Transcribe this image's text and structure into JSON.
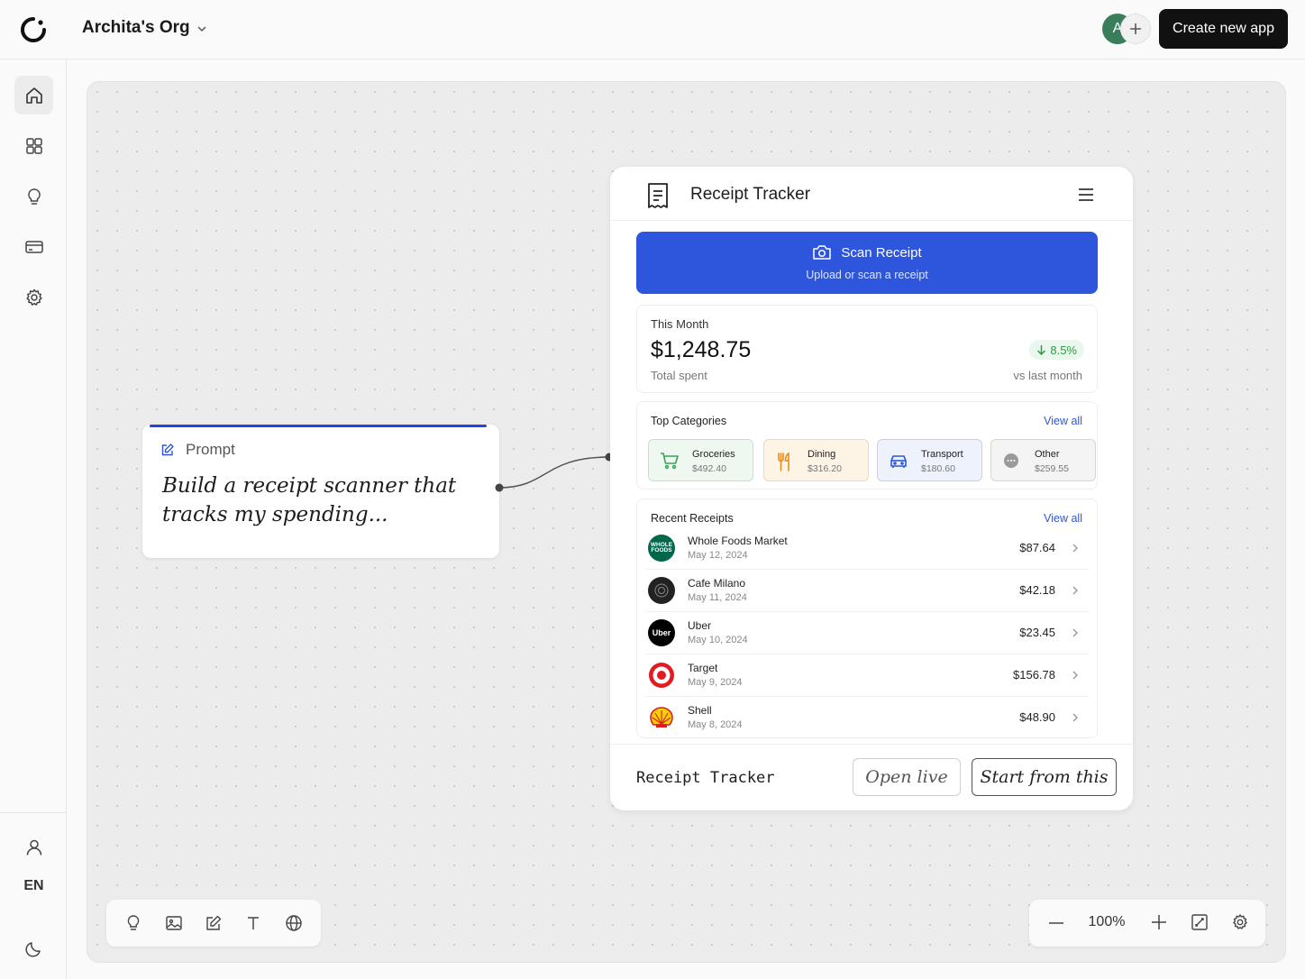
{
  "header": {
    "org_name": "Archita's Org",
    "avatar_initial": "A",
    "create_button": "Create new app"
  },
  "sidebar": {
    "items": [
      {
        "name": "home",
        "icon": "home-icon",
        "active": true
      },
      {
        "name": "apps",
        "icon": "grid-icon"
      },
      {
        "name": "ideas",
        "icon": "lightbulb-icon"
      },
      {
        "name": "billing",
        "icon": "credit-card-icon"
      },
      {
        "name": "settings",
        "icon": "gear-icon"
      }
    ],
    "bottom": {
      "profile_icon": "user-icon",
      "language": "EN",
      "theme_icon": "moon-icon"
    }
  },
  "prompt_node": {
    "label": "Prompt",
    "text": "Build a receipt scanner that tracks my spending..."
  },
  "app_preview": {
    "title": "Receipt Tracker",
    "scan": {
      "label": "Scan Receipt",
      "sublabel": "Upload or scan a receipt"
    },
    "this_month": {
      "label": "This Month",
      "amount": "$1,248.75",
      "sublabel": "Total spent",
      "change": "8.5%",
      "change_direction": "down",
      "change_label": "vs last month"
    },
    "categories": {
      "title": "Top Categories",
      "view_all": "View all",
      "items": [
        {
          "name": "Groceries",
          "amount": "$492.40",
          "icon": "cart-icon",
          "color": "#3aa356"
        },
        {
          "name": "Dining",
          "amount": "$316.20",
          "icon": "utensils-icon",
          "color": "#e6932a"
        },
        {
          "name": "Transport",
          "amount": "$180.60",
          "icon": "car-icon",
          "color": "#2d56dd"
        },
        {
          "name": "Other",
          "amount": "$259.55",
          "icon": "more-icon",
          "color": "#777777"
        }
      ]
    },
    "recent": {
      "title": "Recent Receipts",
      "view_all": "View all",
      "items": [
        {
          "merchant": "Whole Foods Market",
          "date": "May 12, 2024",
          "amount": "$87.64"
        },
        {
          "merchant": "Cafe Milano",
          "date": "May 11, 2024",
          "amount": "$42.18"
        },
        {
          "merchant": "Uber",
          "date": "May 10, 2024",
          "amount": "$23.45"
        },
        {
          "merchant": "Target",
          "date": "May 9, 2024",
          "amount": "$156.78"
        },
        {
          "merchant": "Shell",
          "date": "May 8, 2024",
          "amount": "$48.90"
        }
      ]
    },
    "footer": {
      "title": "Receipt Tracker",
      "open_live": "Open live",
      "start_from": "Start from this"
    }
  },
  "canvas_toolbar": {
    "tools": [
      "lightbulb-icon",
      "image-icon",
      "edit-icon",
      "text-icon",
      "globe-icon"
    ]
  },
  "zoom": {
    "value": "100%"
  },
  "colors": {
    "accent": "#2d56dd",
    "prompt_bar": "#2346d8",
    "positive": "#2e9c4b"
  }
}
